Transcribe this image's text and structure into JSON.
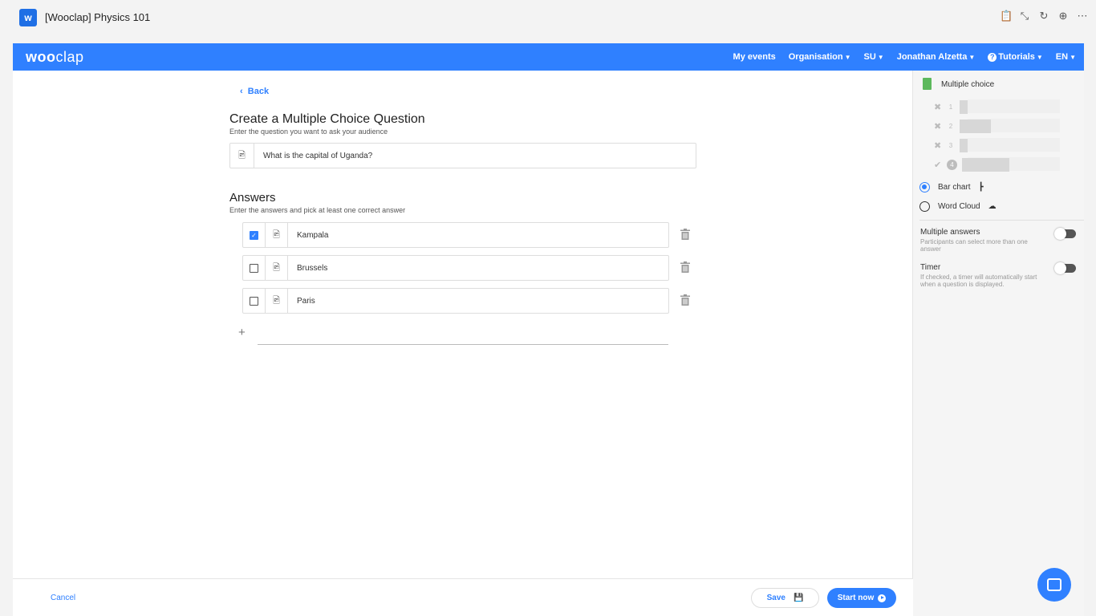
{
  "window": {
    "app_icon_letter": "w",
    "title": "[Wooclap] Physics 101",
    "controls": [
      "📋",
      "⤡",
      "↻",
      "⊕",
      "⋯"
    ]
  },
  "nav": {
    "logo_bold": "woo",
    "logo_light": "clap",
    "items": [
      "My events",
      "Organisation",
      "SU",
      "Jonathan Alzetta",
      "Tutorials",
      "EN"
    ]
  },
  "main": {
    "back": "Back",
    "heading": "Create a Multiple Choice Question",
    "subtext": "Enter the question you want to ask your audience",
    "question": "What is the capital of Uganda?",
    "answers_heading": "Answers",
    "answers_sub": "Enter the answers and pick at least one correct answer",
    "answers": [
      {
        "text": "Kampala",
        "checked": true
      },
      {
        "text": "Brussels",
        "checked": false
      },
      {
        "text": "Paris",
        "checked": false
      }
    ],
    "add_symbol": "+"
  },
  "footer": {
    "cancel": "Cancel",
    "save": "Save",
    "start": "Start now"
  },
  "panel": {
    "title": "Multiple choice",
    "preview_rows": [
      "1",
      "2",
      "3",
      "4"
    ],
    "bar_chart": "Bar chart",
    "word_cloud": "Word Cloud",
    "multiple_answers_title": "Multiple answers",
    "multiple_answers_desc": "Participants can select more than one answer",
    "timer_title": "Timer",
    "timer_desc": "If checked, a timer will automatically start when a question is displayed."
  },
  "colors": {
    "brand": "#2f80ff",
    "accent_green": "#5cb85c"
  }
}
